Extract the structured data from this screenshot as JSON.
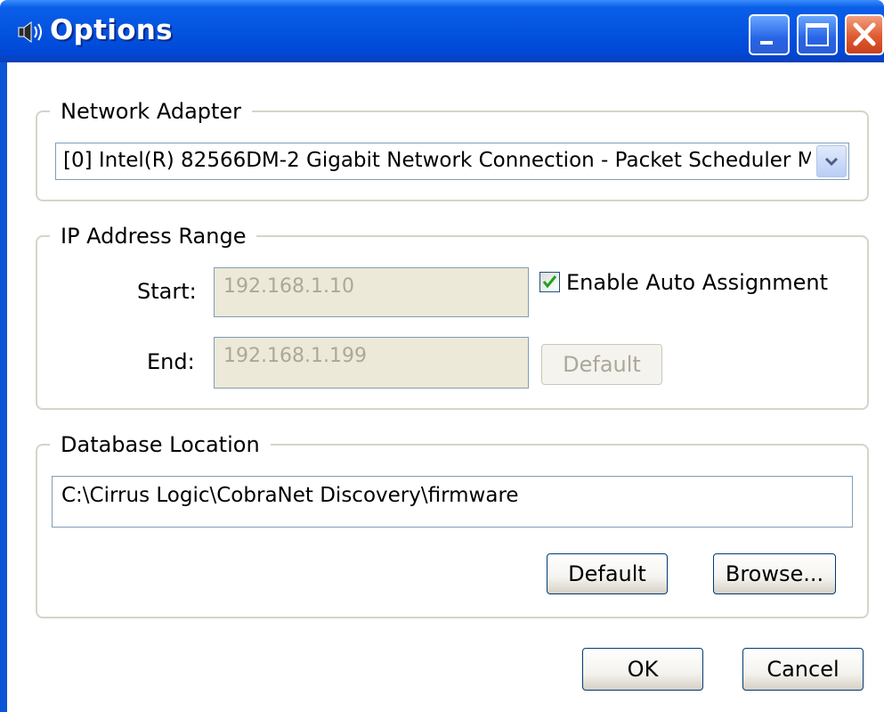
{
  "window": {
    "title": "Options",
    "icon": "speaker-icon",
    "controls": [
      "minimize-icon",
      "maximize-icon",
      "close-icon"
    ],
    "colors": {
      "titlebar": "#0453e0",
      "close": "#e05a30",
      "field_disabled": "#ece9d8"
    }
  },
  "network_adapter": {
    "group_label": "Network Adapter",
    "selected": "[0] Intel(R) 82566DM-2 Gigabit Network Connection - Packet Scheduler M"
  },
  "ip_range": {
    "group_label": "IP Address Range",
    "start_label": "Start:",
    "start_value": "192.168.1.10",
    "end_label": "End:",
    "end_value": "192.168.1.199",
    "auto_assign_label": "Enable Auto Assignment",
    "auto_assign_checked": true,
    "default_label": "Default"
  },
  "database": {
    "group_label": "Database Location",
    "path": "C:\\Cirrus Logic\\CobraNet Discovery\\firmware",
    "default_label": "Default",
    "browse_label": "Browse..."
  },
  "footer": {
    "ok_label": "OK",
    "cancel_label": "Cancel"
  }
}
